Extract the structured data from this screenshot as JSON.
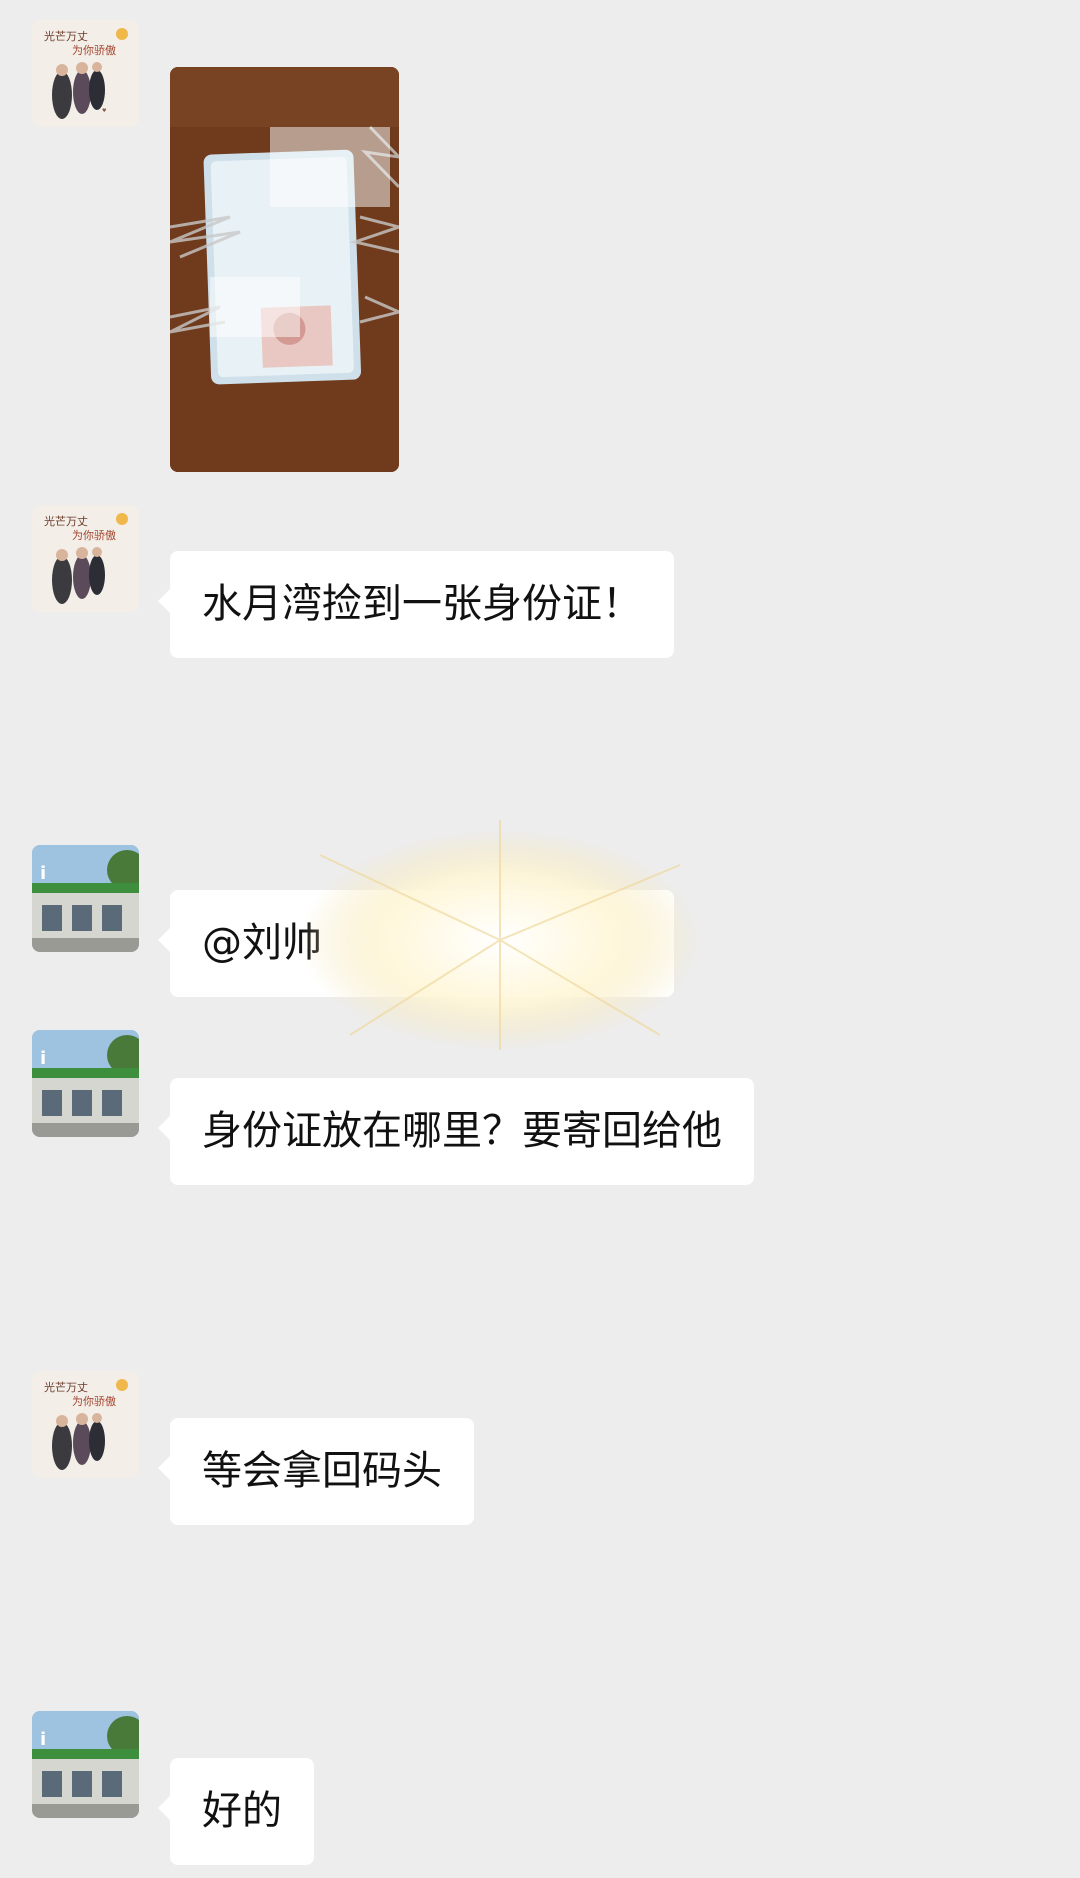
{
  "messages": [
    {
      "sender": "group-avatar",
      "type": "image",
      "alt": ""
    },
    {
      "sender": "group-avatar",
      "type": "text",
      "text": "水月湾捡到一张身份证！"
    },
    {
      "sender": "store-avatar",
      "type": "text",
      "text": "@刘帅"
    },
    {
      "sender": "store-avatar",
      "type": "text",
      "text": "身份证放在哪里？要寄回给他"
    },
    {
      "sender": "group-avatar",
      "type": "text",
      "text": "等会拿回码头"
    },
    {
      "sender": "store-avatar",
      "type": "text",
      "text": "好的"
    }
  ],
  "avatars": {
    "group_avatar_text": [
      "光芒万丈",
      "为你骄傲"
    ],
    "store_avatar_label": ""
  },
  "colors": {
    "background": "#ededed",
    "bubble": "#ffffff",
    "text": "#111111"
  }
}
